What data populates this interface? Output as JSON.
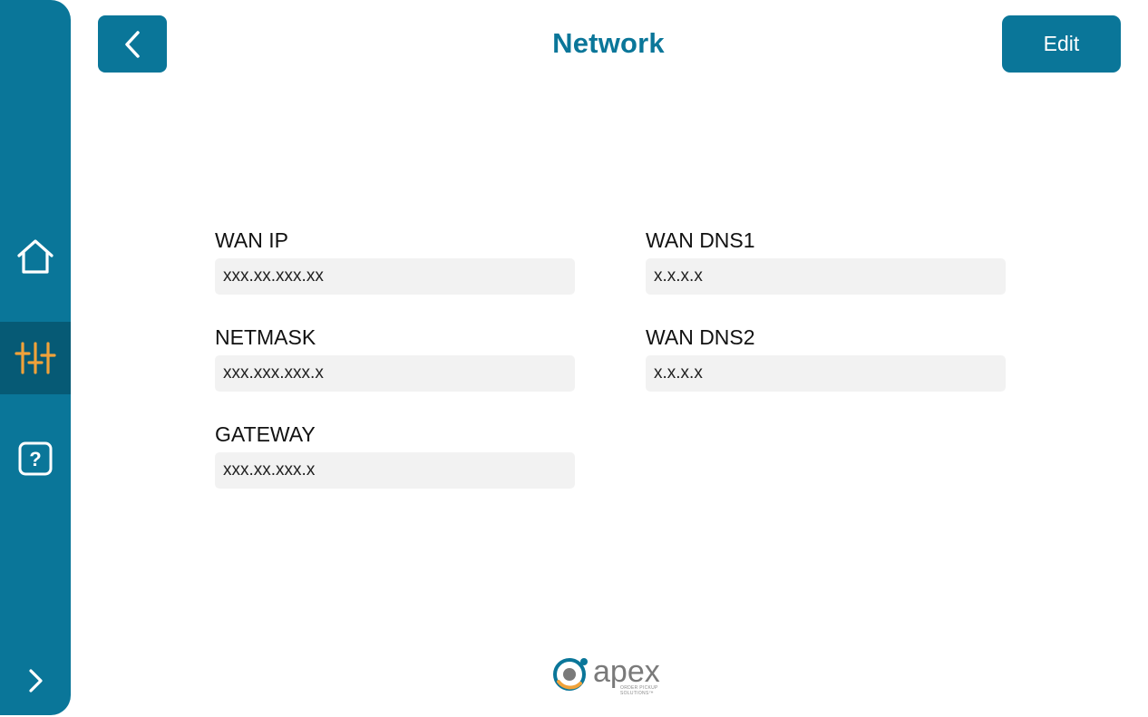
{
  "header": {
    "title": "Network",
    "edit_label": "Edit"
  },
  "sidebar": {
    "items": [
      {
        "icon": "home-icon",
        "active": false
      },
      {
        "icon": "sliders-icon",
        "active": true
      },
      {
        "icon": "help-icon",
        "active": false
      },
      {
        "icon": "chevron-right-icon",
        "active": false
      }
    ]
  },
  "fields": {
    "wan_ip": {
      "label": "WAN IP",
      "value": "xxx.xx.xxx.xx"
    },
    "netmask": {
      "label": "NETMASK",
      "value": "xxx.xxx.xxx.x"
    },
    "gateway": {
      "label": "GATEWAY",
      "value": "xxx.xx.xxx.x"
    },
    "wan_dns1": {
      "label": "WAN DNS1",
      "value": "x.x.x.x"
    },
    "wan_dns2": {
      "label": "WAN DNS2",
      "value": "x.x.x.x"
    }
  },
  "logo": {
    "name": "apex",
    "tagline": "ORDER PICKUP SOLUTIONS™"
  },
  "colors": {
    "primary": "#0a7699",
    "primary_dark": "#065a75",
    "accent": "#f0a23a",
    "field_bg": "#f2f2f2"
  }
}
